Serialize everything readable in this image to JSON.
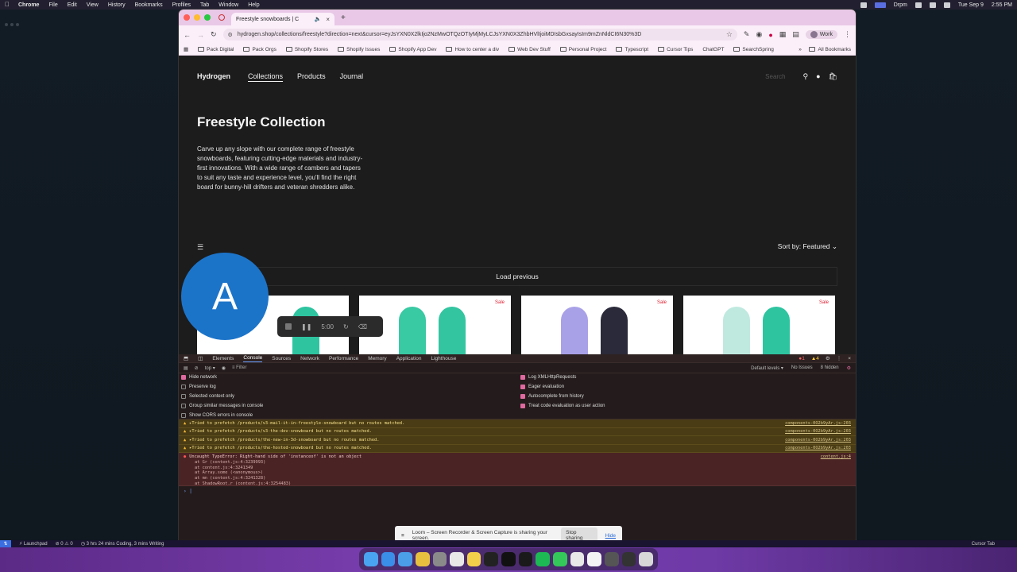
{
  "menubar": {
    "items": [
      "Chrome",
      "File",
      "Edit",
      "View",
      "History",
      "Bookmarks",
      "Profiles",
      "Tab",
      "Window",
      "Help"
    ],
    "right_items": [
      "Drpm",
      "Tue Sep 9",
      "2:55 PM"
    ]
  },
  "browser": {
    "tab_title": "Freestyle snowboards | C",
    "url": "hydrogen.shop/collections/freestyle?direction=next&cursor=eyJsYXN0X2lkIjo2NzMwOTQzOTIyMjMyLCJsYXN0X3ZhbHVlIjoiMDIsbGxsayIsIm9mZnNldCI6N30%3D",
    "profile": "Work",
    "bookmarks": [
      "Pack Digital",
      "Pack Orgs",
      "Shopify Stores",
      "Shopify Issues",
      "Shopify App Dev",
      "How to center a div",
      "Web Dev Stuff",
      "Personal Project",
      "Typescript",
      "Cursor Tips",
      "ChatGPT",
      "SearchSpring"
    ],
    "all_bookmarks": "All Bookmarks"
  },
  "site": {
    "brand": "Hydrogen",
    "nav": [
      "Collections",
      "Products",
      "Journal"
    ],
    "search_placeholder": "Search",
    "title": "Freestyle Collection",
    "description": "Carve up any slope with our complete range of freestyle snowboards, featuring cutting-edge materials and industry-first innovations. With a wide range of cambers and tapers to suit any taste and experience level, you'll find the right board for bunny-hill drifters and veteran shredders alike.",
    "sort_label": "Sort by:",
    "sort_value": "Featured",
    "load_previous": "Load previous",
    "sale_label": "Sale"
  },
  "overlay": {
    "avatar_letter": "A",
    "timer": "5:00"
  },
  "devtools": {
    "tabs": [
      "Elements",
      "Console",
      "Sources",
      "Network",
      "Performance",
      "Memory",
      "Application",
      "Lighthouse"
    ],
    "error_count": "1",
    "warn_count": "4",
    "context": "top",
    "filter_placeholder": "Filter",
    "levels": "Default levels",
    "issues": "No Issues",
    "hidden": "8 hidden",
    "left_options": [
      "Hide network",
      "Preserve log",
      "Selected context only",
      "Group similar messages in console",
      "Show CORS errors in console"
    ],
    "right_options": [
      "Log XMLHttpRequests",
      "Eager evaluation",
      "Autocomplete from history",
      "Treat code evaluation as user action"
    ],
    "warnings": [
      "Tried to prefetch /products/v3-mail-it-in-freestyle-snowboard but no routes matched.",
      "Tried to prefetch /products/v3-the-dev-snowboard but no routes matched.",
      "Tried to prefetch /products/the-new-in-3d-snowboard but no routes matched.",
      "Tried to prefetch /products/the-hosted-snowboard but no routes matched."
    ],
    "warning_source": "components-0O2b9yAr.js:203",
    "error_message": "Uncaught TypeError: Right-hand side of 'instanceof' is not an object",
    "error_source": "content.js:4",
    "stack": [
      "at Gr (content.js:4:3239993)",
      "at content.js:4:3241349",
      "at Array.some (<anonymous>)",
      "at mn (content.js:4:3241328)",
      "at ShadowRoot.r (content.js:4:3254483)"
    ]
  },
  "loom": {
    "message": "Loom – Screen Recorder & Screen Capture is sharing your screen.",
    "stop": "Stop sharing",
    "hide": "Hide"
  },
  "statusbar": {
    "launchpad": "Launchpad",
    "counts": "⊘ 0 ⚠ 0",
    "coding": "3 hrs 24 mins Coding, 3 mins Writing",
    "cursor_tab": "Cursor Tab"
  }
}
